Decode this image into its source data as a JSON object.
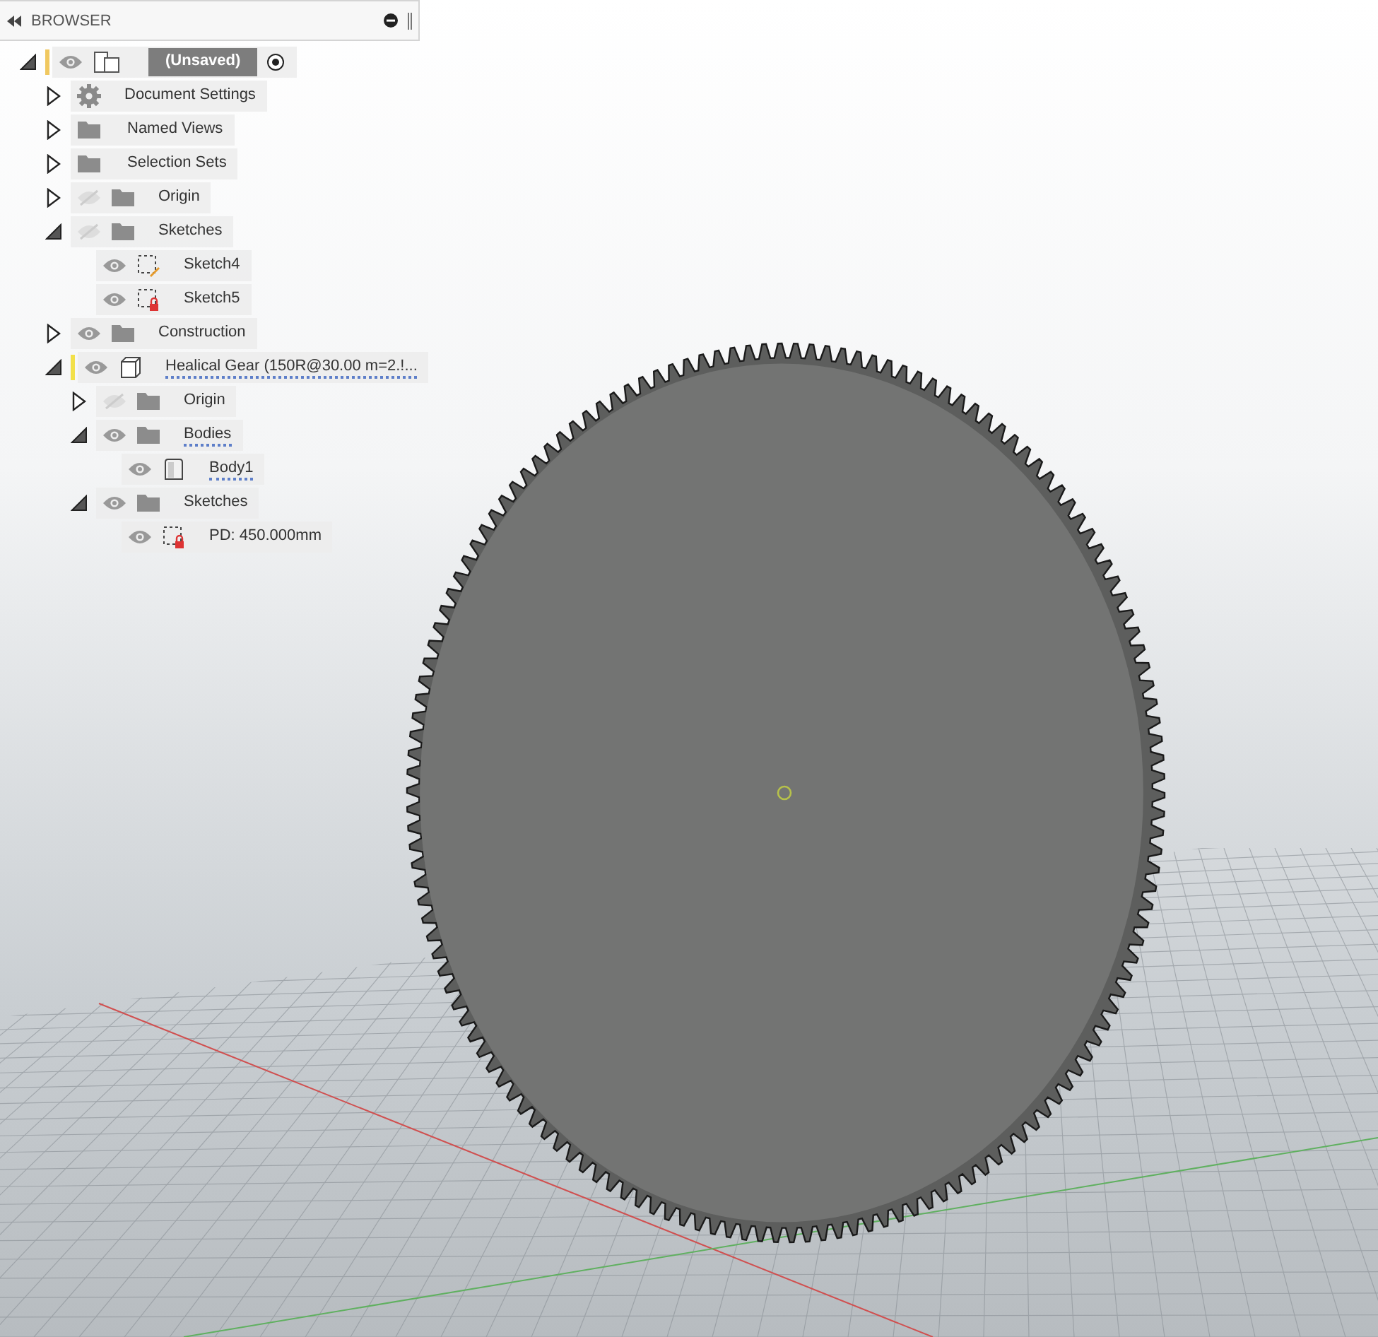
{
  "browser": {
    "title": "BROWSER",
    "tree": [
      {
        "label": "(Unsaved)",
        "kind": "document",
        "visible": true,
        "expanded": true,
        "selected": true,
        "active": true,
        "color": "#f0c860",
        "warning": false,
        "children": [
          {
            "label": "Document Settings",
            "kind": "gear",
            "expanded": false,
            "selected": false,
            "warning": false
          },
          {
            "label": "Named Views",
            "kind": "folder",
            "expanded": false,
            "selected": false,
            "warning": false
          },
          {
            "label": "Selection Sets",
            "kind": "folder",
            "expanded": false,
            "selected": false,
            "warning": false
          },
          {
            "label": "Origin",
            "kind": "folder",
            "visible": false,
            "expanded": false,
            "selected": false,
            "warning": false
          },
          {
            "label": "Sketches",
            "kind": "folder",
            "visible": false,
            "expanded": true,
            "selected": false,
            "warning": false,
            "children": [
              {
                "label": "Sketch4",
                "kind": "sketch-edit",
                "visible": true,
                "selected": false,
                "warning": false
              },
              {
                "label": "Sketch5",
                "kind": "sketch-locked",
                "visible": true,
                "selected": false,
                "warning": false
              }
            ]
          },
          {
            "label": "Construction",
            "kind": "folder",
            "visible": true,
            "expanded": false,
            "selected": false,
            "warning": false
          },
          {
            "label": "Healical Gear (150R@30.00 m=2.!...",
            "kind": "component",
            "visible": true,
            "expanded": true,
            "selected": false,
            "color": "#f2e04a",
            "warning": true,
            "children": [
              {
                "label": "Origin",
                "kind": "folder",
                "visible": false,
                "expanded": false,
                "selected": false,
                "warning": false
              },
              {
                "label": "Bodies",
                "kind": "folder",
                "visible": true,
                "expanded": true,
                "selected": false,
                "warning": true,
                "children": [
                  {
                    "label": "Body1",
                    "kind": "body",
                    "visible": true,
                    "selected": false,
                    "warning": true
                  }
                ]
              },
              {
                "label": "Sketches",
                "kind": "folder",
                "visible": true,
                "expanded": true,
                "selected": false,
                "warning": false,
                "children": [
                  {
                    "label": "PD: 450.000mm",
                    "kind": "sketch-locked",
                    "visible": true,
                    "selected": false,
                    "warning": false
                  }
                ]
              }
            ]
          }
        ]
      }
    ]
  }
}
